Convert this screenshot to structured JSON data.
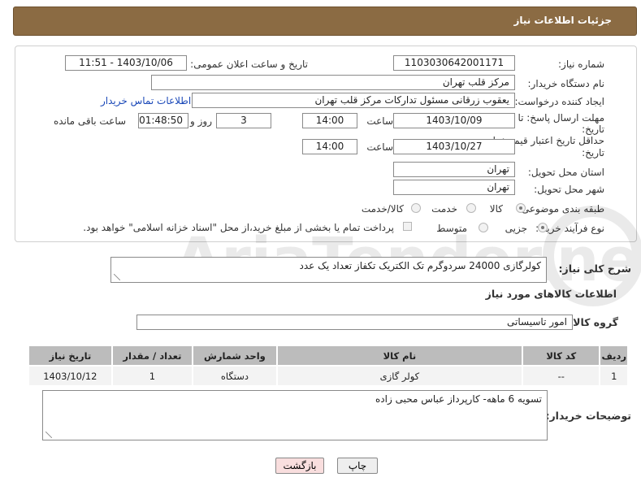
{
  "header": {
    "title": "جزئیات اطلاعات نیاز"
  },
  "form": {
    "need_number_label": "شماره نیاز:",
    "need_number": "1103030642001171",
    "announce_label": "تاریخ و ساعت اعلان عمومی:",
    "announce_value": "1403/10/06 - 11:51",
    "buyer_org_label": "نام دستگاه خریدار:",
    "buyer_org": "مرکز قلب تهران",
    "creator_label": "ایجاد کننده درخواست:",
    "creator": "یعقوب زرقانی مسئول تدارکات مرکز قلب تهران",
    "contact_link": "اطلاعات تماس خریدار",
    "reply_deadline_label_1": "مهلت ارسال پاسخ: تا",
    "reply_deadline_label_2": "تاریخ:",
    "reply_date": "1403/10/09",
    "time_label": "ساعت",
    "reply_time": "14:00",
    "days_value": "3",
    "days_label": "روز و",
    "remaining_time": "01:48:50",
    "remaining_label": "ساعت باقی مانده",
    "price_deadline_label_1": "حداقل تاریخ اعتبار قیمت: تا",
    "price_deadline_label_2": "تاریخ:",
    "price_date": "1403/10/27",
    "price_time": "14:00",
    "province_label": "استان محل تحویل:",
    "province": "تهران",
    "city_label": "شهر محل تحویل:",
    "city": "تهران",
    "category_label": "طبقه بندی موضوعی:",
    "category_options": [
      "کالا",
      "خدمت",
      "کالا/خدمت"
    ],
    "purchase_type_label": "نوع فرآیند خرید :",
    "purchase_options": [
      "جزیی",
      "متوسط"
    ],
    "payment_note": "پرداخت تمام یا بخشی از مبلغ خرید،از محل \"اسناد خزانه اسلامی\" خواهد بود."
  },
  "description": {
    "label": "شرح کلی نیاز:",
    "text": "کولرگازی 24000 سردوگرم تک الکتریک تکفاز تعداد یک عدد"
  },
  "goods": {
    "section_title": "اطلاعات کالاهای مورد نیاز",
    "group_label": "گروه کالا:",
    "group_value": "امور تاسیساتی",
    "columns": [
      "ردیف",
      "کد کالا",
      "نام کالا",
      "واحد شمارش",
      "تعداد / مقدار",
      "تاریخ نیاز"
    ],
    "rows": [
      [
        "1",
        "--",
        "کولر گازی",
        "دستگاه",
        "1",
        "1403/10/12"
      ]
    ]
  },
  "buyer_notes": {
    "label": "توضیحات خریدار:",
    "text": "تسویه 6 ماهه- کارپرداز عباس محبی زاده"
  },
  "buttons": {
    "print": "چاپ",
    "back": "بازگشت"
  },
  "watermark": "AriaTender.net",
  "colors": {
    "header": "#8b6b43",
    "link": "#1a48b8",
    "back_button": "#f9dede"
  }
}
